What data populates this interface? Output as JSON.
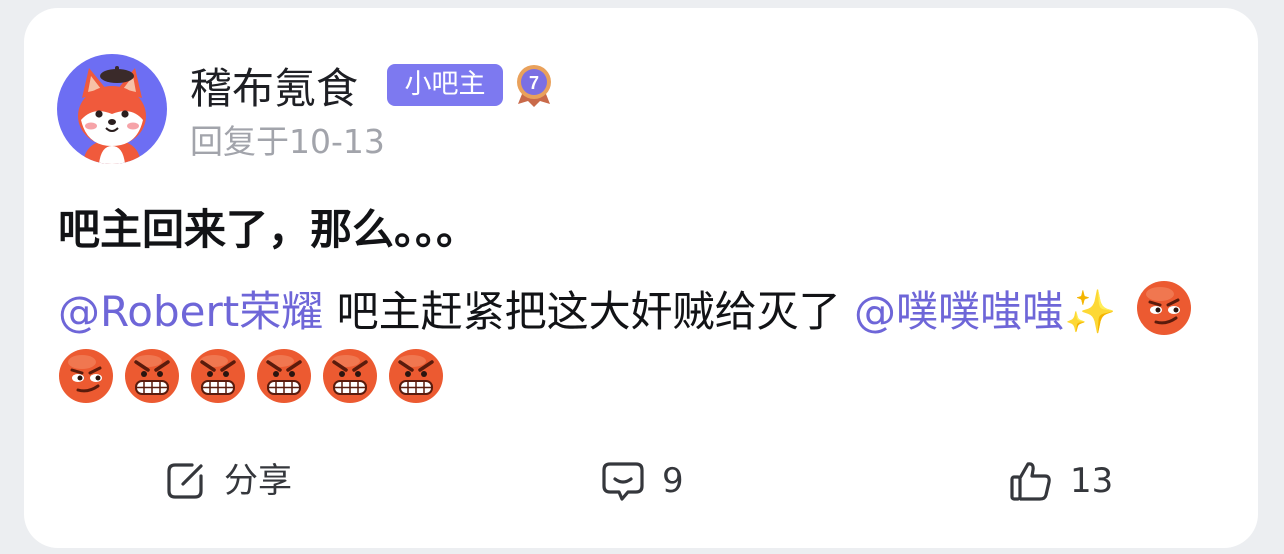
{
  "post": {
    "author": "稽布氪食",
    "author_badge": "小吧主",
    "level": "7",
    "reply_time": "回复于10-13",
    "title": "吧主回来了，那么。。。",
    "body": {
      "mention_1": "@Robert荣耀",
      "text": " 吧主赶紧把这大奸贼给灭了 ",
      "mention_2": "@噗噗嗤嗤",
      "sparkle": "✨"
    },
    "emojis": [
      "smirk-face-emoji",
      "smirk-face-emoji",
      "angry-grin-emoji",
      "angry-grin-emoji",
      "angry-grin-emoji",
      "angry-grin-emoji",
      "angry-grin-emoji"
    ]
  },
  "actions": {
    "share_label": "分享",
    "comment_count": "9",
    "like_count": "13"
  },
  "colors": {
    "mention": "#6e66d8",
    "badge": "#7d79f0",
    "avatar_bg": "#6d6ef3",
    "emoji": "#ec5a31"
  }
}
